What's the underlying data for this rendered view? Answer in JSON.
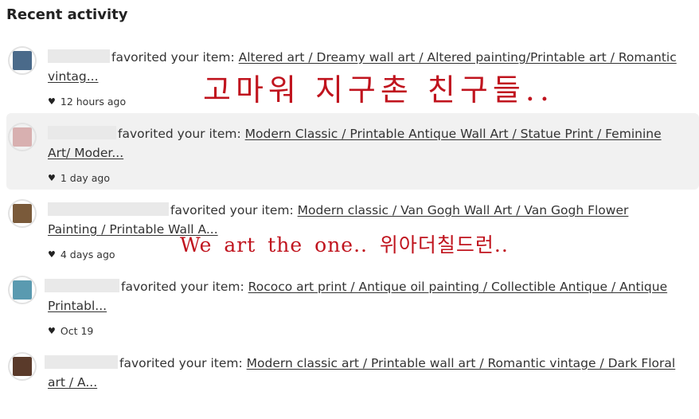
{
  "page": {
    "heading": "Recent activity"
  },
  "activities": [
    {
      "action": "favorited your item:",
      "item_title": "Altered art / Dreamy wall art / Altered painting/Printable art / Romantic vintag...",
      "time": "12 hours ago",
      "thumb_color": "#4a6a8a"
    },
    {
      "action": "favorited your item:",
      "item_title": "Modern Classic / Printable Antique Wall Art / Statue Print / Feminine Art/ Moder...",
      "time": "1 day ago",
      "thumb_color": "#d8b0b0"
    },
    {
      "action": "favorited your item:",
      "item_title": "Modern classic / Van Gogh Wall Art / Van Gogh Flower Painting / Printable Wall A...",
      "time": "4 days ago",
      "thumb_color": "#7a5a3a"
    },
    {
      "action": "favorited your item:",
      "item_title": "Rococo art print / Antique oil painting / Collectible Antique / Antique Printabl...",
      "time": "Oct 19",
      "thumb_color": "#5a9ab0"
    },
    {
      "action": "favorited your item:",
      "item_title": "Modern classic art / Printable wall art / Romantic vintage / Dark Floral art / A...",
      "time": "",
      "thumb_color": "#5a3a2a"
    }
  ],
  "overlays": {
    "korean_caption": "고마워 지구촌 친구들..",
    "mixed_caption": "We art the one.. 위아더칠드런.."
  },
  "colors": {
    "overlay_red": "#c0141e",
    "highlight_bg": "#f1f1f1"
  },
  "icons": {
    "favorite": "heart-icon"
  }
}
